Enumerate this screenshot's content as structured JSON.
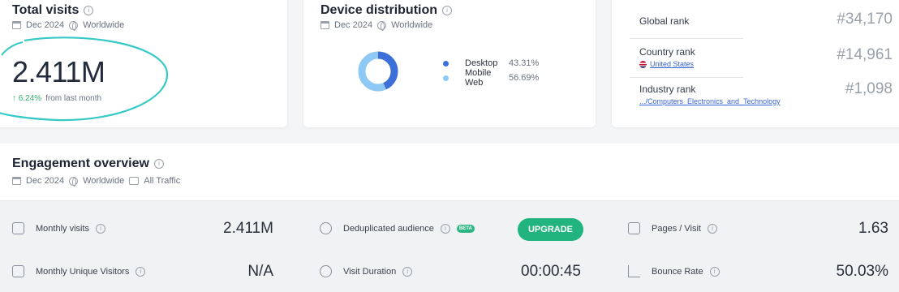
{
  "total_visits": {
    "title": "Total visits",
    "date": "Dec 2024",
    "region": "Worldwide",
    "value": "2.411M",
    "change": "↑ 6.24%",
    "change_label": "from last month"
  },
  "device_distribution": {
    "title": "Device distribution",
    "date": "Dec 2024",
    "region": "Worldwide",
    "items": [
      {
        "label": "Desktop",
        "value": "43.31%",
        "share": 43.31,
        "color": "#3d6fd9"
      },
      {
        "label": "Mobile Web",
        "value": "56.69%",
        "share": 56.69,
        "color": "#8ec9f5"
      }
    ]
  },
  "ranks": {
    "global": {
      "label": "Global rank",
      "value": "#34,170"
    },
    "country": {
      "label": "Country rank",
      "sub": "United States",
      "value": "#14,961"
    },
    "industry": {
      "label": "Industry rank",
      "sub": ".../Computers_Electronics_and_Technology",
      "value": "#1,098"
    }
  },
  "engagement": {
    "title": "Engagement overview",
    "date": "Dec 2024",
    "region": "Worldwide",
    "traffic": "All Traffic",
    "metrics": {
      "monthly_visits": {
        "label": "Monthly visits",
        "value": "2.411M"
      },
      "unique_visitors": {
        "label": "Monthly Unique Visitors",
        "value": "N/A"
      },
      "dedup_audience": {
        "label": "Deduplicated audience",
        "badge": "BETA",
        "button": "UPGRADE"
      },
      "visit_duration": {
        "label": "Visit Duration",
        "value": "00:00:45"
      },
      "pages_per_visit": {
        "label": "Pages / Visit",
        "value": "1.63"
      },
      "bounce_rate": {
        "label": "Bounce Rate",
        "value": "50.03%"
      }
    }
  },
  "colors": {
    "accent": "#21b47f",
    "annotation": "#36c9c6",
    "link": "#3a63d6"
  }
}
